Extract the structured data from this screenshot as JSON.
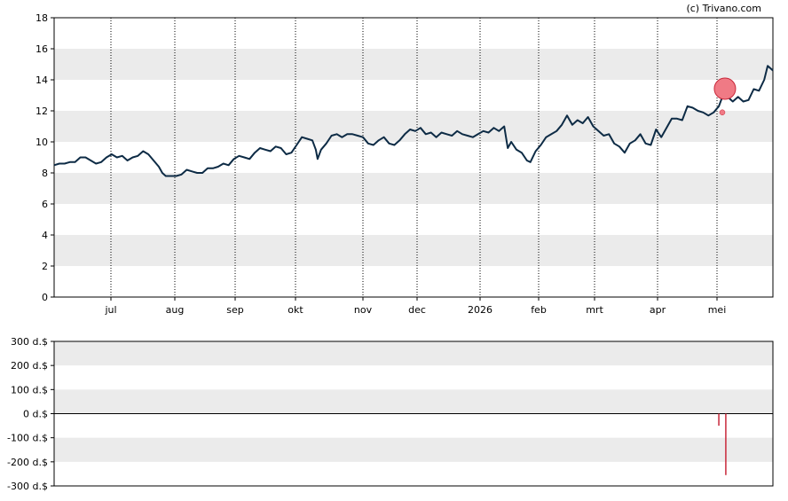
{
  "credit": "(c) Trivano.com",
  "colors": {
    "band": "#ebebeb",
    "price_line": "#0d2b45",
    "marker": "#f07a85",
    "marker_stroke": "#c8283a",
    "bar": "#c8283a",
    "vgrid": "#000000",
    "axis": "#000000"
  },
  "chart_data": [
    {
      "type": "line",
      "y_ticks": [
        "0",
        "2",
        "4",
        "6",
        "8",
        "10",
        "12",
        "14",
        "16",
        "18"
      ],
      "x_tick_labels": [
        "jul",
        "aug",
        "sep",
        "okt",
        "nov",
        "dec",
        "2026",
        "feb",
        "mrt",
        "apr",
        "mei"
      ],
      "ylim": [
        0,
        18
      ],
      "grid": "alternating horizontal bands, dotted vertical month lines",
      "series": [
        {
          "values": [
            [
              0,
              8.5
            ],
            [
              3,
              8.6
            ],
            [
              6,
              8.6
            ],
            [
              9,
              8.7
            ],
            [
              12,
              8.7
            ],
            [
              15,
              9.0
            ],
            [
              18,
              9.0
            ],
            [
              21,
              8.8
            ],
            [
              24,
              8.6
            ],
            [
              27,
              8.7
            ],
            [
              30,
              9.0
            ],
            [
              33,
              9.2
            ],
            [
              36,
              9.0
            ],
            [
              39,
              9.1
            ],
            [
              42,
              8.8
            ],
            [
              45,
              9.0
            ],
            [
              48,
              9.1
            ],
            [
              51,
              9.4
            ],
            [
              54,
              9.2
            ],
            [
              57,
              8.8
            ],
            [
              60,
              8.4
            ],
            [
              62,
              8.0
            ],
            [
              64,
              7.8
            ],
            [
              67,
              7.8
            ],
            [
              70,
              7.8
            ],
            [
              73,
              7.9
            ],
            [
              76,
              8.2
            ],
            [
              79,
              8.1
            ],
            [
              82,
              8.0
            ],
            [
              85,
              8.0
            ],
            [
              88,
              8.3
            ],
            [
              91,
              8.3
            ],
            [
              94,
              8.4
            ],
            [
              97,
              8.6
            ],
            [
              100,
              8.5
            ],
            [
              103,
              8.9
            ],
            [
              106,
              9.1
            ],
            [
              109,
              9.0
            ],
            [
              112,
              8.9
            ],
            [
              115,
              9.3
            ],
            [
              118,
              9.6
            ],
            [
              121,
              9.5
            ],
            [
              124,
              9.4
            ],
            [
              127,
              9.7
            ],
            [
              130,
              9.6
            ],
            [
              133,
              9.2
            ],
            [
              136,
              9.3
            ],
            [
              139,
              9.8
            ],
            [
              142,
              10.3
            ],
            [
              145,
              10.2
            ],
            [
              148,
              10.1
            ],
            [
              150,
              9.5
            ],
            [
              151,
              8.9
            ],
            [
              153,
              9.5
            ],
            [
              156,
              9.9
            ],
            [
              159,
              10.4
            ],
            [
              162,
              10.5
            ],
            [
              165,
              10.3
            ],
            [
              168,
              10.5
            ],
            [
              171,
              10.5
            ],
            [
              174,
              10.4
            ],
            [
              177,
              10.3
            ],
            [
              180,
              9.9
            ],
            [
              183,
              9.8
            ],
            [
              186,
              10.1
            ],
            [
              189,
              10.3
            ],
            [
              192,
              9.9
            ],
            [
              195,
              9.8
            ],
            [
              198,
              10.1
            ],
            [
              201,
              10.5
            ],
            [
              204,
              10.8
            ],
            [
              207,
              10.7
            ],
            [
              210,
              10.9
            ],
            [
              213,
              10.5
            ],
            [
              216,
              10.6
            ],
            [
              219,
              10.3
            ],
            [
              222,
              10.6
            ],
            [
              225,
              10.5
            ],
            [
              228,
              10.4
            ],
            [
              231,
              10.7
            ],
            [
              234,
              10.5
            ],
            [
              237,
              10.4
            ],
            [
              240,
              10.3
            ],
            [
              243,
              10.5
            ],
            [
              246,
              10.7
            ],
            [
              249,
              10.6
            ],
            [
              252,
              10.9
            ],
            [
              255,
              10.7
            ],
            [
              258,
              11.0
            ],
            [
              260,
              9.6
            ],
            [
              262,
              10.0
            ],
            [
              265,
              9.5
            ],
            [
              268,
              9.3
            ],
            [
              271,
              8.8
            ],
            [
              273,
              8.7
            ],
            [
              276,
              9.4
            ],
            [
              279,
              9.8
            ],
            [
              282,
              10.3
            ],
            [
              285,
              10.5
            ],
            [
              288,
              10.7
            ],
            [
              291,
              11.1
            ],
            [
              294,
              11.7
            ],
            [
              297,
              11.1
            ],
            [
              300,
              11.4
            ],
            [
              303,
              11.2
            ],
            [
              306,
              11.6
            ],
            [
              309,
              11.0
            ],
            [
              312,
              10.7
            ],
            [
              315,
              10.4
            ],
            [
              318,
              10.5
            ],
            [
              321,
              9.9
            ],
            [
              324,
              9.7
            ],
            [
              327,
              9.3
            ],
            [
              330,
              9.9
            ],
            [
              333,
              10.1
            ],
            [
              336,
              10.5
            ],
            [
              339,
              9.9
            ],
            [
              342,
              9.8
            ],
            [
              345,
              10.8
            ],
            [
              348,
              10.3
            ],
            [
              351,
              10.9
            ],
            [
              354,
              11.5
            ],
            [
              357,
              11.5
            ],
            [
              360,
              11.4
            ],
            [
              363,
              12.3
            ],
            [
              366,
              12.2
            ],
            [
              369,
              12.0
            ],
            [
              372,
              11.9
            ],
            [
              375,
              11.7
            ],
            [
              378,
              11.9
            ],
            [
              381,
              12.3
            ],
            [
              384,
              13.2
            ],
            [
              386,
              12.9
            ],
            [
              389,
              12.6
            ],
            [
              392,
              12.9
            ],
            [
              395,
              12.6
            ],
            [
              398,
              12.7
            ],
            [
              401,
              13.4
            ],
            [
              404,
              13.3
            ],
            [
              407,
              14.0
            ],
            [
              409,
              14.9
            ],
            [
              412,
              14.6
            ]
          ]
        }
      ],
      "annotations": [
        {
          "type": "transaction",
          "x": 384,
          "y": 13.2
        },
        {
          "type": "transaction",
          "x": 383,
          "y": 11.9
        }
      ]
    },
    {
      "type": "bar",
      "y_ticks": [
        "300 d.$",
        "200 d.$",
        "100 d.$",
        "0 d.$",
        "-100 d.$",
        "-200 d.$",
        "-300 d.$"
      ],
      "ylim": [
        -300,
        300
      ],
      "bars": [
        {
          "x": 381,
          "value": -50
        },
        {
          "x": 385,
          "value": -255
        }
      ]
    }
  ]
}
